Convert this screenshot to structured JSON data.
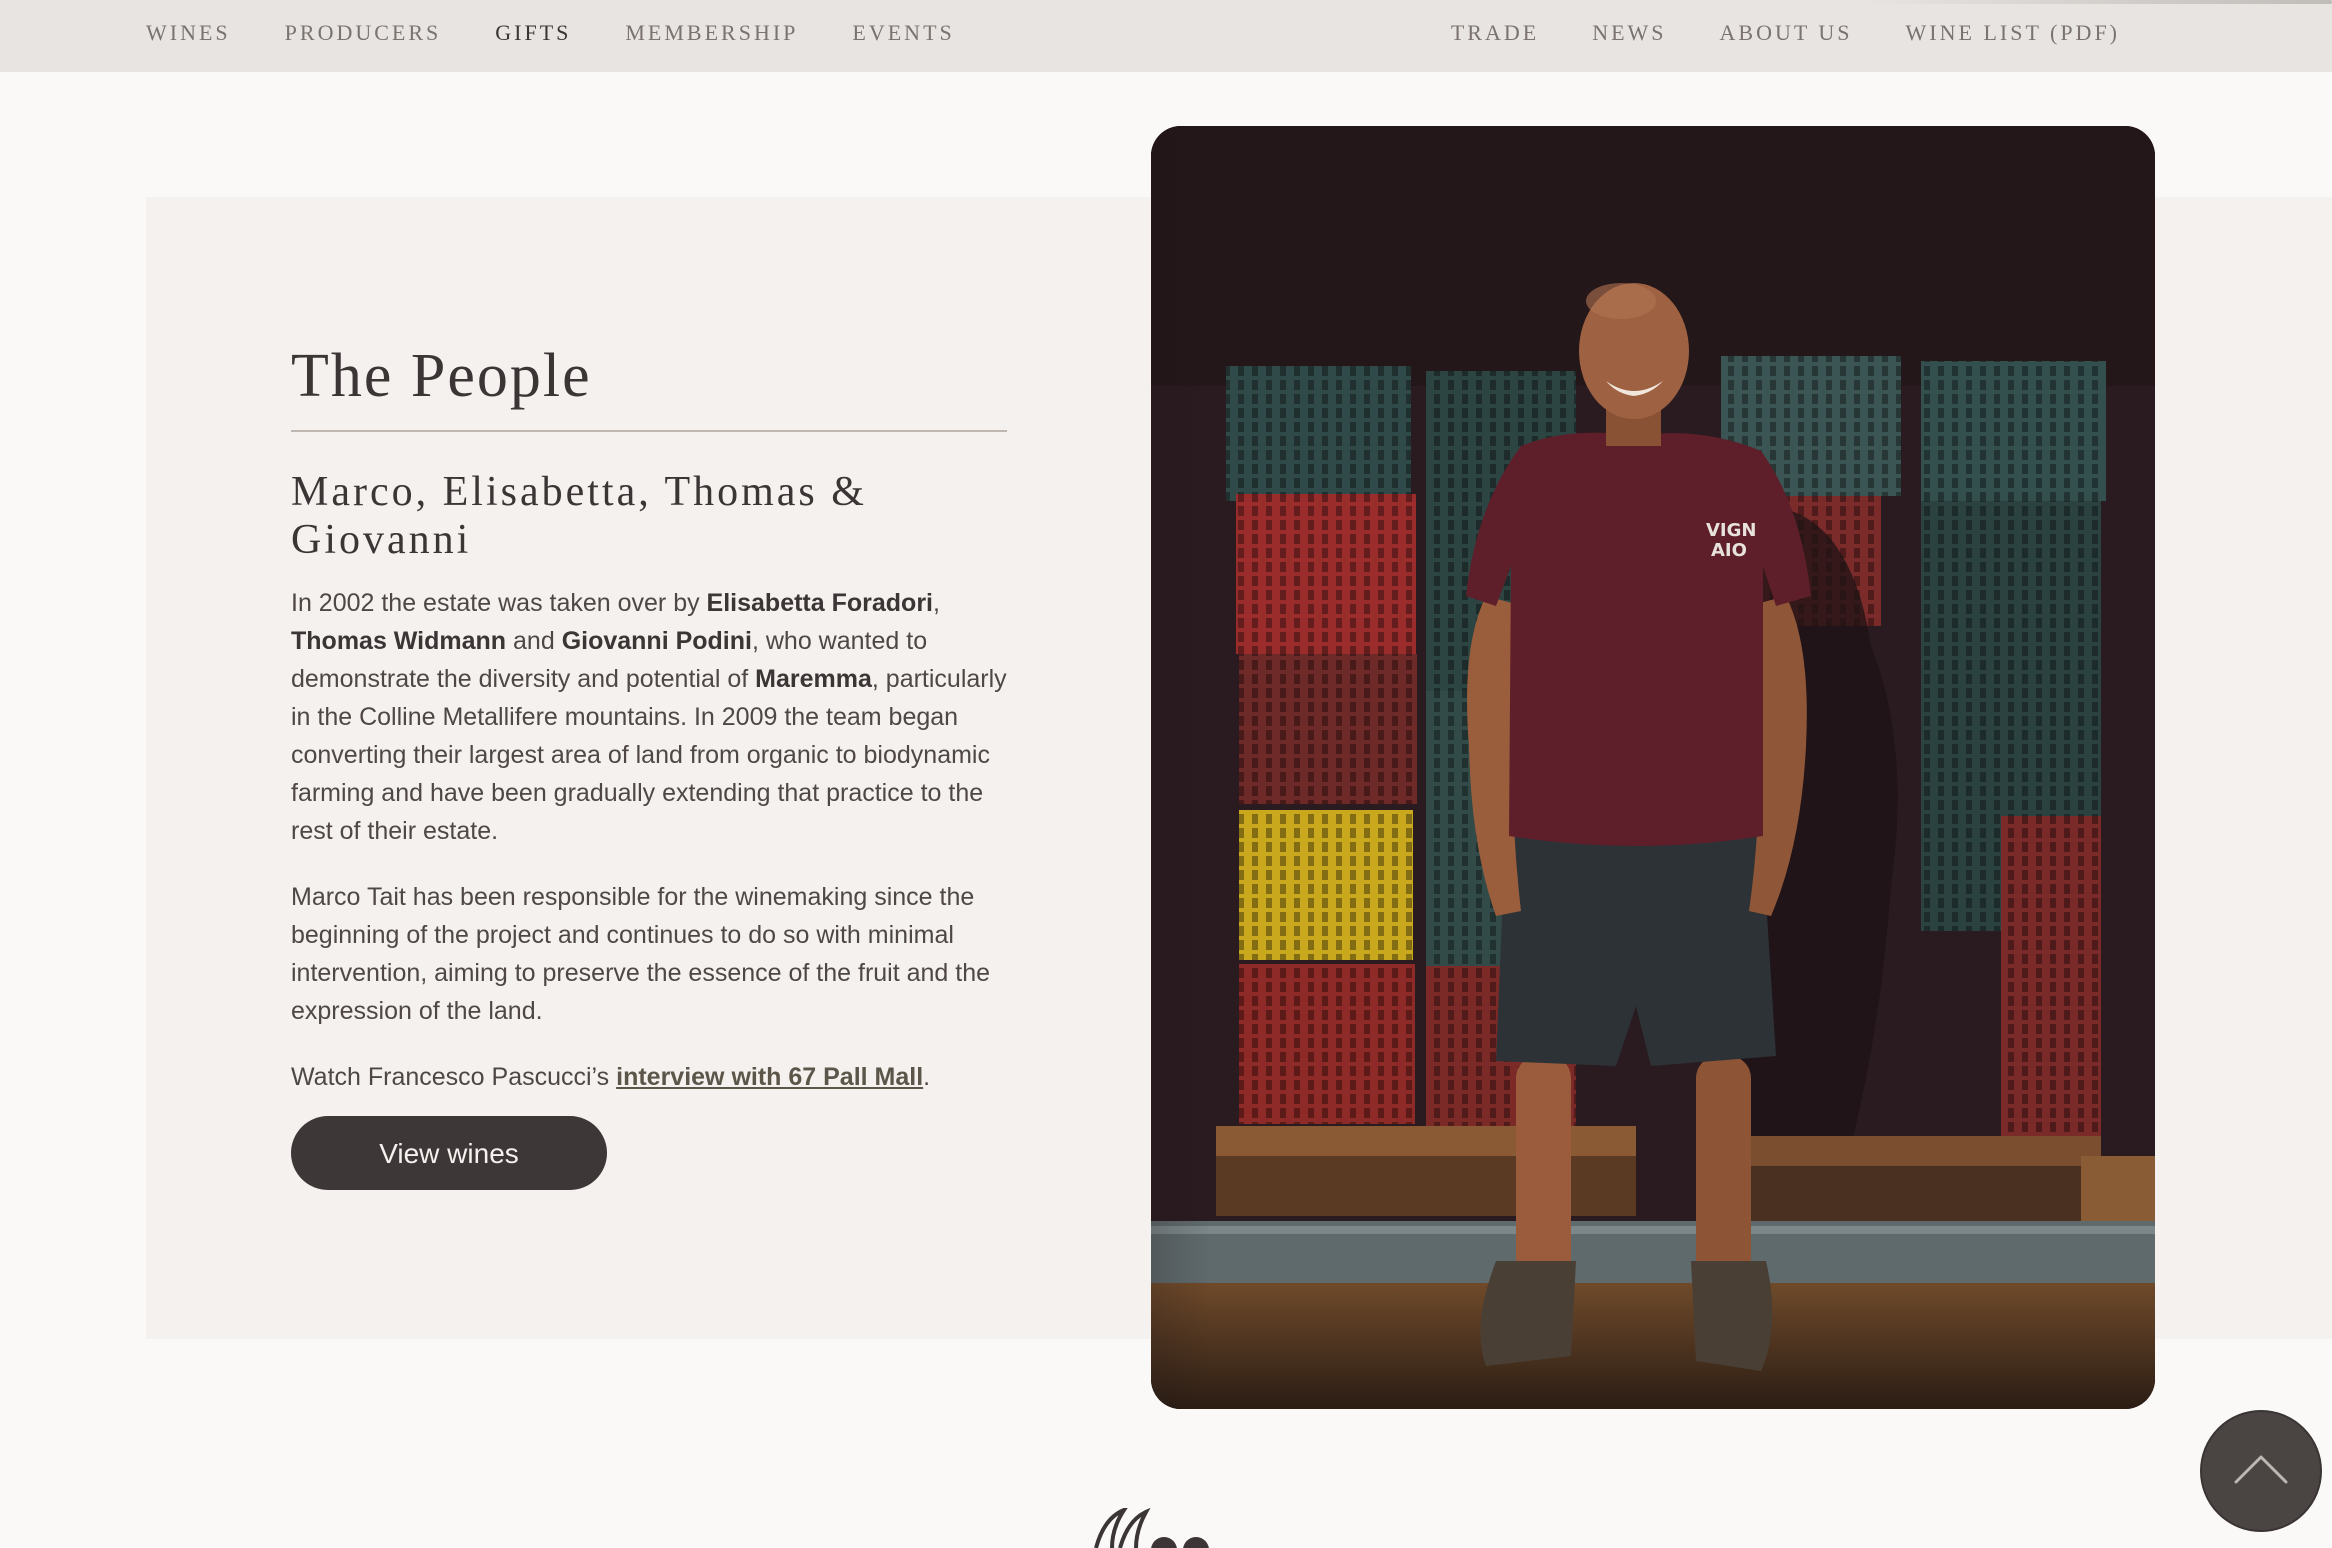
{
  "nav": {
    "left": [
      {
        "label": "WINES"
      },
      {
        "label": "PRODUCERS"
      },
      {
        "label": "GIFTS"
      },
      {
        "label": "MEMBERSHIP"
      },
      {
        "label": "EVENTS"
      }
    ],
    "right": [
      {
        "label": "TRADE"
      },
      {
        "label": "NEWS"
      },
      {
        "label": "ABOUT US"
      },
      {
        "label": "WINE LIST (PDF)"
      }
    ],
    "active": "GIFTS"
  },
  "people": {
    "title": "The People",
    "subtitle": "Marco, Elisabetta, Thomas & Giovanni",
    "p1": {
      "t1": "In 2002 the estate was taken over by ",
      "b1": "Elisabetta Foradori",
      "t2": ", ",
      "b2": "Thomas Widmann",
      "t3": " and ",
      "b3": "Giovanni Podini",
      "t4": ", who wanted to demonstrate the diversity and potential of ",
      "b4": "Maremma",
      "t5": ", particularly in the Colline Metallifere mountains. In 2009 the team began converting their largest area of land from organic to biodynamic farming and have been gradually extending that practice to the rest of their estate."
    },
    "p2": "Marco Tait has been responsible for the winemaking since the beginning of the project and continues to do so with minimal intervention, aiming to preserve the essence of the fruit and the expression of the land.",
    "p3": {
      "prefix": "Watch Francesco Pascucci’s ",
      "link": "interview with 67 Pall Mall",
      "suffix": "."
    },
    "button": "View wines",
    "photo_tshirt_text": "VIGN AIO"
  },
  "colors": {
    "nav_bg": "#e8e4e1",
    "page_bg": "#faf9f7",
    "panel_bg": "#f4f1ee",
    "text_dark": "#3b3535",
    "button_bg": "#3e3737",
    "link": "#5b5649"
  },
  "icons": {
    "scroll_top": "chevron-up-icon",
    "quote": "quote-mark-icon"
  }
}
